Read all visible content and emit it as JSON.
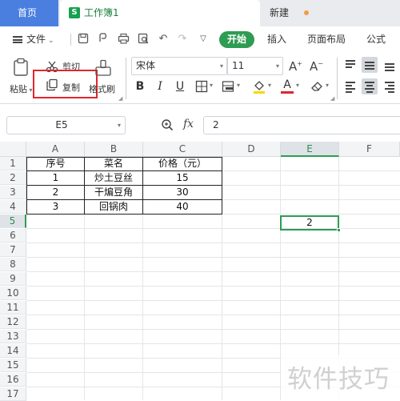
{
  "tabs": {
    "home": "首页",
    "doc": "工作簿1",
    "doc_icon": "S",
    "new": "新建"
  },
  "menu": {
    "file": "文件",
    "start": "开始",
    "insert": "插入",
    "page_layout": "页面布局",
    "formula": "公式"
  },
  "ribbon": {
    "paste": "粘贴",
    "cut": "剪切",
    "copy": "复制",
    "format_painter": "格式刷",
    "font_name": "宋体",
    "font_size": "11",
    "bold": "B",
    "italic": "I",
    "underline": "U"
  },
  "formula_bar": {
    "name_box": "E5",
    "fx": "fx",
    "value": "2"
  },
  "columns": [
    "A",
    "B",
    "C",
    "D",
    "E",
    "F"
  ],
  "rows": [
    "1",
    "2",
    "3",
    "4",
    "5",
    "6",
    "7",
    "8",
    "9",
    "10",
    "11",
    "12",
    "13",
    "14",
    "15",
    "16",
    "17"
  ],
  "table": {
    "header": [
      "序号",
      "菜名",
      "价格（元）"
    ],
    "rows": [
      [
        "1",
        "炒土豆丝",
        "15"
      ],
      [
        "2",
        "干煸豆角",
        "30"
      ],
      [
        "3",
        "回锅肉",
        "40"
      ]
    ]
  },
  "selected_cell_value": "2",
  "watermark": "软件技巧",
  "colors": {
    "accent_green": "#2e9c52",
    "home_tab": "#4a7fe0",
    "highlight": "#e0262e"
  }
}
